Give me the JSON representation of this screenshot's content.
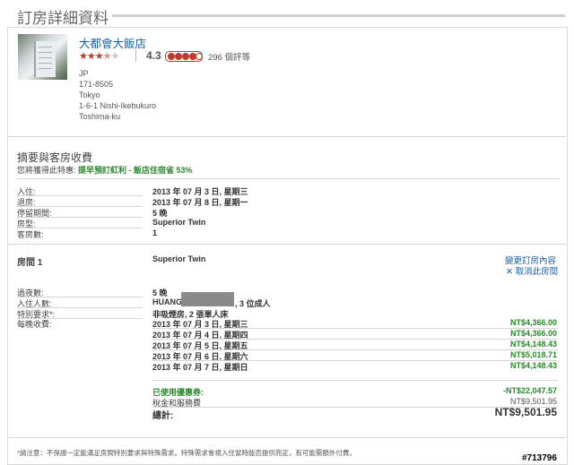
{
  "header": {
    "title": "訂房詳細資料"
  },
  "hotel": {
    "name": "大都會大飯店",
    "score": "4.3",
    "reviews": "296 個評等",
    "address": [
      "JP",
      "171-8505",
      "Tokyo",
      "1-6-1 Nishi-Ikebukuro",
      "Toshima-ku"
    ]
  },
  "summary": {
    "title": "摘要與客房收費",
    "offer_prefix": "您將獲得此特惠: ",
    "offer_text": "提早預訂紅利 - 飯店住宿省 53%",
    "rows": [
      {
        "label": "入住:",
        "value": "2013 年 07 月 3 日, 星期三"
      },
      {
        "label": "退房:",
        "value": "2013 年 07 月 8 日, 星期一"
      },
      {
        "label": "停留期間:",
        "value": "5 晚"
      },
      {
        "label": "房型:",
        "value": "Superior Twin"
      },
      {
        "label": "客房數:",
        "value": "1"
      }
    ]
  },
  "room": {
    "label": "房間 1",
    "type": "Superior Twin",
    "change_link": "變更訂房內容",
    "cancel_link": "取消此房間",
    "nights_label": "過夜數:",
    "nights_value": "5 晚",
    "guests_label": "入住人數:",
    "guest_name": "HUANG",
    "guest_count": ", 3 位成人",
    "special_label": "特別要求*:",
    "special_value": "非吸煙房, 2 張單人床",
    "nightly_label": "每晚收費:",
    "nightly": [
      {
        "date": "2013 年 07 月 3 日, 星期三",
        "price": "NT$4,366.00"
      },
      {
        "date": "2013 年 07 月 4 日, 星期四",
        "price": "NT$4,366.00"
      },
      {
        "date": "2013 年 07 月 5 日, 星期五",
        "price": "NT$4,148.43"
      },
      {
        "date": "2013 年 07 月 6 日, 星期六",
        "price": "NT$5,018.71"
      },
      {
        "date": "2013 年 07 月 7 日, 星期日",
        "price": "NT$4,148.43"
      }
    ]
  },
  "totals": {
    "discount_label": "已使用優惠券:",
    "discount_value": "-NT$22,047.57",
    "tax_label": "稅金和服務費",
    "tax_value": "NT$9,501.95",
    "total_label": "總計:",
    "total_value": "NT$9,501.95"
  },
  "footnote": "*請注意：不保證一定能滿足房間特別要求與特殊需求。特殊需求會視入住當時能否提供而定，有可能需額外付費。",
  "watermark": "#713796",
  "colors": {
    "link": "#1a5fa6",
    "green": "#2a8a2a",
    "star": "#c0392b"
  }
}
